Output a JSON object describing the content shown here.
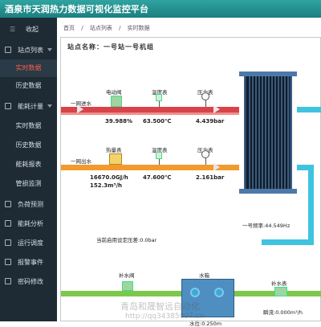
{
  "app": {
    "title": "酒泉市天润热力数据可视化监控平台"
  },
  "sidebar": {
    "collapse_label": "收起",
    "items": [
      {
        "label": "站点列表",
        "type": "group",
        "icon": "home-icon"
      },
      {
        "label": "实时数据",
        "type": "sub",
        "active": true
      },
      {
        "label": "历史数据",
        "type": "sub"
      },
      {
        "label": "能耗计量",
        "type": "group",
        "icon": "meter-icon"
      },
      {
        "label": "实时数据",
        "type": "sub"
      },
      {
        "label": "历史数据",
        "type": "sub"
      },
      {
        "label": "能耗报表",
        "type": "sub"
      },
      {
        "label": "管损监测",
        "type": "sub"
      },
      {
        "label": "负荷预测",
        "type": "group",
        "icon": "forecast-icon"
      },
      {
        "label": "能耗分析",
        "type": "group",
        "icon": "analysis-icon"
      },
      {
        "label": "运行调度",
        "type": "group",
        "icon": "dispatch-icon"
      },
      {
        "label": "报警事件",
        "type": "group",
        "icon": "alarm-icon"
      },
      {
        "label": "密码修改",
        "type": "group",
        "icon": "lock-icon"
      }
    ]
  },
  "breadcrumb": [
    "首页",
    "站点列表",
    "实时数据"
  ],
  "station": {
    "name": "站点名称：一号站一号机组"
  },
  "diagram": {
    "supply_label": "一网进水",
    "return_label": "一网出水",
    "valve_label": "电动阀",
    "valve_value": "39.988%",
    "temp_label_1": "温度表",
    "temp_value_1": "63.500℃",
    "pressure_label_1": "压力表",
    "pressure_value_1": "4.439bar",
    "heat_meter_label": "热量表",
    "heat_value": "16670.0GJ/h",
    "flow_value": "152.3m³/h",
    "temp_label_2": "温度表",
    "temp_value_2": "47.600℃",
    "pressure_label_2": "压力表",
    "pressure_value_2": "2.161bar",
    "pump_freq_label": "一号频率:44.549Hz",
    "setpoint_label": "当前启用设定压差:0.0bar",
    "makeup_valve_label": "补水阀",
    "tank_label": "水箱",
    "makeup_meter_label": "补水表",
    "level_label": "水位:0.250m",
    "makeup_flow_label": "瞬流:0.000m³/h"
  },
  "watermark": {
    "line1": "青岛和晟智远自动化",
    "line2": "http://qq34385007.cn"
  },
  "colors": {
    "topbar": "#2fa3a0",
    "sidebar": "#1e2b35",
    "active": "#ff5d4a",
    "supply": "#d8434a",
    "return": "#f29a2e",
    "secondary": "#3ec4e0",
    "makeup": "#7cc84a"
  }
}
